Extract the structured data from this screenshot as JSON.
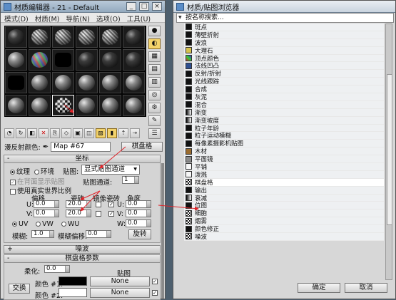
{
  "material_editor": {
    "title": "材质编辑器 - 21 - Default",
    "menu": [
      "模式(D)",
      "材质(M)",
      "导航(N)",
      "选项(O)",
      "工具(U)"
    ],
    "map_label": "漫反射颜色:",
    "map_name": "Map #67",
    "map_type_button": "棋盘格",
    "coords": {
      "header": "坐标",
      "texture_label": "纹理",
      "env_label": "环境",
      "mapping_label": "贴图:",
      "mapping_value": "显式贴图通道",
      "show_in_viewport": "在背面显示贴图",
      "map_channel_label": "贴图通道:",
      "map_channel_value": "1",
      "real_world_label": "使用真实世界比例",
      "offset_label": "偏移",
      "tiling_label": "瓷砖",
      "mirror_label": "镜像",
      "tile_label": "瓷砖",
      "angle_label": "角度",
      "u_label": "U:",
      "v_label": "V:",
      "w_label": "W:",
      "u_offset": "0.0",
      "v_offset": "0.0",
      "u_tiling": "20.0",
      "v_tiling": "20.0",
      "u_angle": "0.0",
      "v_angle": "0.0",
      "w_angle": "0.0",
      "uv_label": "UV",
      "vw_label": "VW",
      "wu_label": "WU",
      "blur_label": "模糊:",
      "blur_value": "1.0",
      "blur_offset_label": "模糊偏移:",
      "blur_offset_value": "0.0",
      "rotate_button": "旋转"
    },
    "noise_header": "噪波",
    "checker": {
      "header": "棋盘格参数",
      "soften_label": "柔化:",
      "soften_value": "0.0",
      "maps_label": "贴图",
      "swap_button": "交换",
      "color1_label": "颜色 #1:",
      "color2_label": "颜色 #2:",
      "none1": "None",
      "none2": "None",
      "color1": "#000000",
      "color2": "#ffffff"
    }
  },
  "browser": {
    "title": "材质/贴图浏览器",
    "search_placeholder": "按名称搜索...",
    "items": [
      {
        "label": "斑点",
        "icon": "black"
      },
      {
        "label": "薄壁折射",
        "icon": "black"
      },
      {
        "label": "波浪",
        "icon": "black"
      },
      {
        "label": "大理石",
        "icon": "yellow"
      },
      {
        "label": "顶点颜色",
        "icon": "vertex-color"
      },
      {
        "label": "法线凹凸",
        "icon": "blue"
      },
      {
        "label": "反射/折射",
        "icon": "black"
      },
      {
        "label": "光线跟踪",
        "icon": "black"
      },
      {
        "label": "合成",
        "icon": "black"
      },
      {
        "label": "灰泥",
        "icon": "black"
      },
      {
        "label": "混合",
        "icon": "black"
      },
      {
        "label": "渐变",
        "icon": "gradient"
      },
      {
        "label": "渐变坡度",
        "icon": "gradient"
      },
      {
        "label": "粒子年龄",
        "icon": "black"
      },
      {
        "label": "粒子运动模糊",
        "icon": "black"
      },
      {
        "label": "每像素摄影机贴图",
        "icon": "black"
      },
      {
        "label": "木材",
        "icon": "wood"
      },
      {
        "label": "平面镜",
        "icon": "gray"
      },
      {
        "label": "平铺",
        "icon": "white"
      },
      {
        "label": "泼溅",
        "icon": "white"
      },
      {
        "label": "棋盘格",
        "icon": "checker"
      },
      {
        "label": "输出",
        "icon": "black"
      },
      {
        "label": "衰减",
        "icon": "gradient"
      },
      {
        "label": "位图",
        "icon": "black"
      },
      {
        "label": "细胞",
        "icon": "checker"
      },
      {
        "label": "烟雾",
        "icon": "checker"
      },
      {
        "label": "颜色修正",
        "icon": "black"
      },
      {
        "label": "噪波",
        "icon": "checker"
      }
    ],
    "selected_item": "棋盘格",
    "ok_button": "确定",
    "cancel_button": "取消"
  }
}
